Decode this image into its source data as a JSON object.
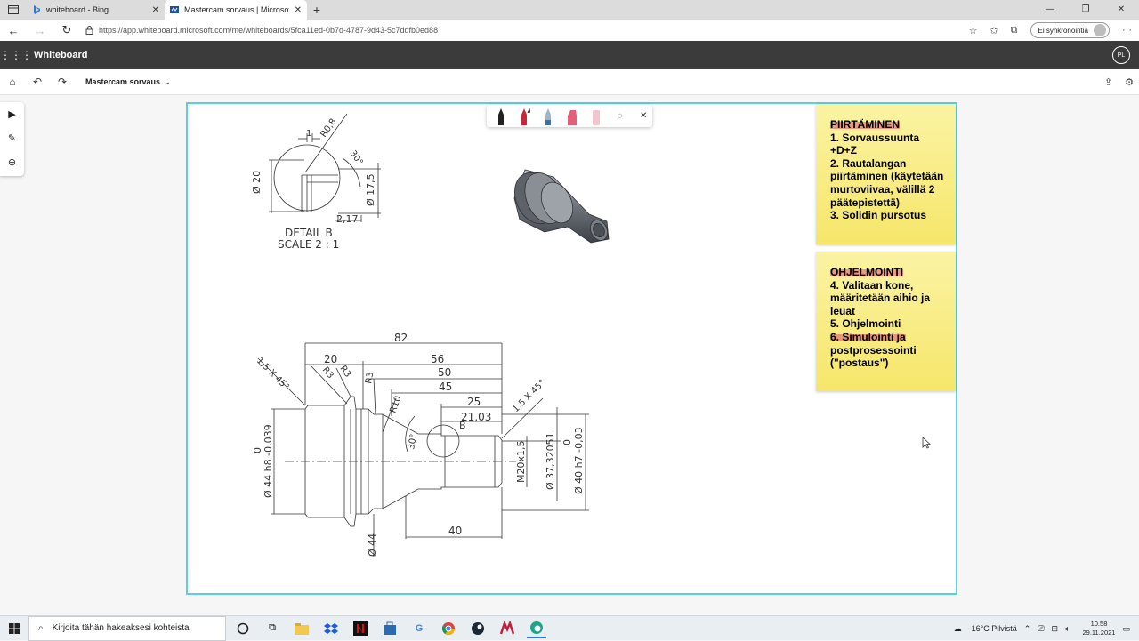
{
  "browser": {
    "tabs": [
      {
        "label": "whiteboard - Bing",
        "icon": "bing-icon",
        "active": false
      },
      {
        "label": "Mastercam sorvaus | Microsoft W",
        "icon": "whiteboard-icon",
        "active": true
      }
    ],
    "new_tab": "+",
    "url": "https://app.whiteboard.microsoft.com/me/whiteboards/5fca11ed-0b7d-4787-9d43-5c7ddfb0ed88",
    "sync_label": "Ei synkronointia"
  },
  "app": {
    "name": "Whiteboard",
    "user_initials": "PL",
    "board_name": "Mastercam sorvaus"
  },
  "notes": [
    {
      "heading": "PIIRTÄMINEN",
      "lines": [
        "1. Sorvaussuunta +D+Z",
        "2. Rautalangan piirtäminen (käytetään murtoviivaa, välillä 2 pääte­pistettä)",
        "3. Solidin pursotus"
      ]
    },
    {
      "heading": "OHJELMOINTI",
      "line4": "4. Valitaan kone, määritetään aihio ja leuat",
      "line5": "5. Ohjelmointi",
      "line6_highlight": "6. Simulointi ja",
      "line6_rest": "postprosessointi (\"postaus\")"
    }
  ],
  "detail": {
    "title": "DETAIL B",
    "scale": "SCALE 2 : 1",
    "dims": {
      "r": "R0,8",
      "one": "1",
      "angle": "30°",
      "d20": "Ø 20",
      "d175": "Ø 17,5",
      "d217": "2,17"
    }
  },
  "part": {
    "top_dims": [
      "82",
      "20",
      "56",
      "50",
      "45",
      "25",
      "21,03"
    ],
    "bottom_dim": "40",
    "chamfer_left": "1,5 X 45°",
    "chamfer_right": "1,5 X 45°",
    "radii": [
      "R3",
      "R3",
      "R3",
      "R10"
    ],
    "angle": "30°",
    "detail_ref": "B",
    "d44tol": "Ø 44 h8 -0,039",
    "d44tol_zero": "0",
    "d44": "Ø 44",
    "thread": "M20x1,5",
    "d37": "Ø 37,32051",
    "d40tol": "Ø 40 h7 -0,03",
    "d40tol_zero": "0"
  },
  "taskbar": {
    "search_placeholder": "Kirjoita tähän hakeaksesi kohteista",
    "weather": "-16°C  Pilvistä",
    "time": "10.58",
    "date": "29.11.2021"
  }
}
